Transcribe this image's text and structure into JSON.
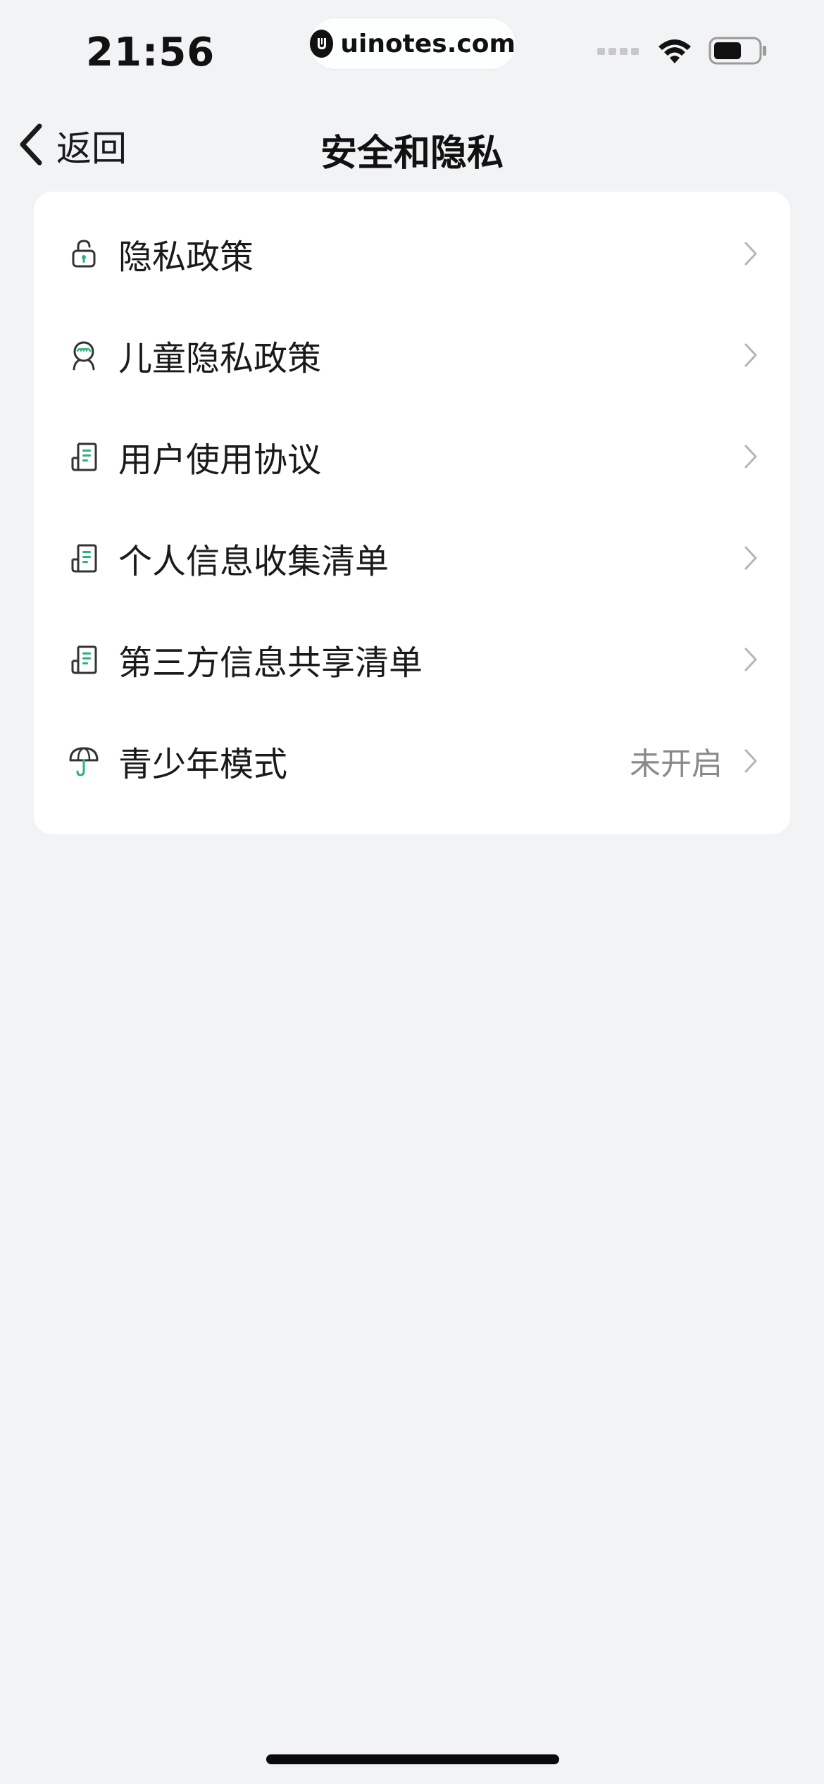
{
  "status_bar": {
    "time": "21:56",
    "watermark": "uinotes.com"
  },
  "nav": {
    "back_label": "返回",
    "title": "安全和隐私"
  },
  "menu": {
    "items": [
      {
        "label": "隐私政策",
        "icon": "lock-icon",
        "value": ""
      },
      {
        "label": "儿童隐私政策",
        "icon": "child-icon",
        "value": ""
      },
      {
        "label": "用户使用协议",
        "icon": "document-icon",
        "value": ""
      },
      {
        "label": "个人信息收集清单",
        "icon": "document-icon",
        "value": ""
      },
      {
        "label": "第三方信息共享清单",
        "icon": "document-icon",
        "value": ""
      },
      {
        "label": "青少年模式",
        "icon": "umbrella-icon",
        "value": "未开启"
      }
    ]
  },
  "colors": {
    "accent": "#2db37a",
    "background": "#f2f3f5",
    "card": "#ffffff",
    "muted_text": "#8a8a8a",
    "chevron": "#b5b5b5"
  }
}
